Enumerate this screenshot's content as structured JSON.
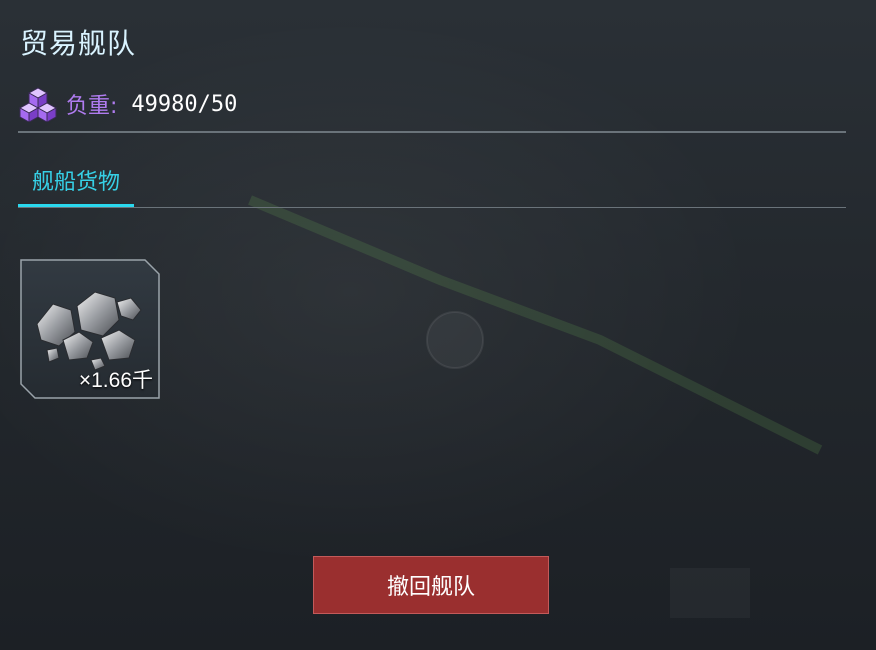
{
  "panel": {
    "title": "贸易舰队"
  },
  "load": {
    "icon": "cubes-icon",
    "label": "负重:",
    "value": "49980/50",
    "label_color": "#b07cf0"
  },
  "tabs": [
    {
      "label": "舰船货物",
      "active": true
    }
  ],
  "cargo": {
    "items": [
      {
        "icon": "ore-icon",
        "quantity": "×1.66千"
      }
    ]
  },
  "actions": {
    "recall_label": "撤回舰队",
    "recall_color": "#9a2f2f"
  },
  "colors": {
    "accent": "#2ad8ee",
    "title": "#d9f3ff"
  }
}
